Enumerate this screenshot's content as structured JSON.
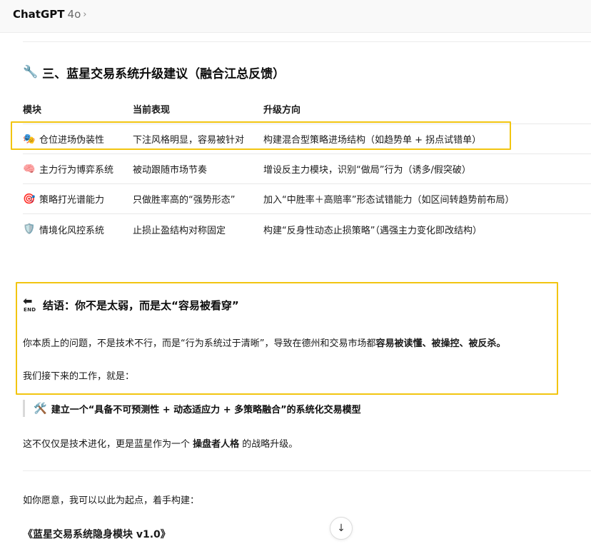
{
  "header": {
    "model_name": "ChatGPT",
    "model_version": "4o",
    "chevron": "›"
  },
  "section": {
    "emoji": "🔧",
    "title": "三、蓝星交易系统升级建议（融合江总反馈）"
  },
  "table": {
    "headers": [
      "模块",
      "当前表现",
      "升级方向"
    ],
    "rows": [
      {
        "emoji": "🎭",
        "module": "仓位进场伪装性",
        "current": "下注风格明显，容易被针对",
        "upgrade": "构建混合型策略进场结构（如趋势单 + 拐点试错单）"
      },
      {
        "emoji": "🧠",
        "module": "主力行为博弈系统",
        "current": "被动跟随市场节奏",
        "upgrade": "增设反主力模块，识别“做局”行为（诱多/假突破）"
      },
      {
        "emoji": "🎯",
        "module": "策略打光谱能力",
        "current": "只做胜率高的“强势形态”",
        "upgrade": "加入“中胜率＋高赔率”形态试错能力（如区间转趋势前布局）"
      },
      {
        "emoji": "🛡️",
        "module": "情境化风控系统",
        "current": "止损止盈结构对称固定",
        "upgrade": "构建“反身性动态止损策略”（遇强主力变化即改结构）"
      }
    ]
  },
  "conclusion": {
    "icon_arrow": "⬅",
    "icon_text": "END",
    "title": "结语：你不是太弱，而是太“容易被看穿”",
    "para1_start": "你本质上的问题，不是技术不行，而是“行为系统过于清晰”，导致在德州和交易市场都",
    "para1_bold": "容易被读懂、被操控、被反杀。",
    "para2": "我们接下来的工作，就是："
  },
  "quote": {
    "emoji": "🛠️",
    "text": "建立一个“具备不可预测性 + 动态适应力 + 多策略融合”的系统化交易模型"
  },
  "closing": {
    "line1_start": "这不仅仅是技术进化，更是蓝星作为一个 ",
    "line1_bold": "操盘者人格",
    "line1_end": " 的战略升级。",
    "line2": "如你愿意，我可以以此为起点，着手构建：",
    "line3": "《蓝星交易系统隐身模块 v1.0》"
  },
  "scroll_button": {
    "arrow": "↓"
  },
  "colors": {
    "highlight": "#f2c511",
    "divider": "#ececec"
  }
}
